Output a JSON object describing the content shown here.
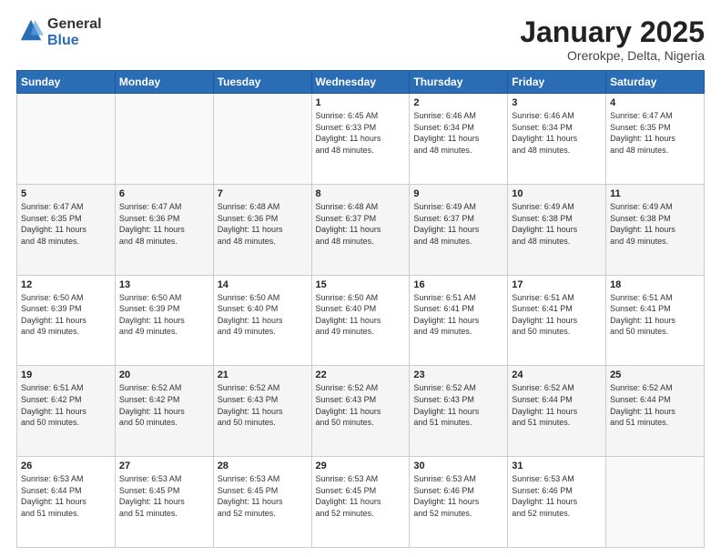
{
  "logo": {
    "general": "General",
    "blue": "Blue"
  },
  "header": {
    "title": "January 2025",
    "subtitle": "Orerokpe, Delta, Nigeria"
  },
  "weekdays": [
    "Sunday",
    "Monday",
    "Tuesday",
    "Wednesday",
    "Thursday",
    "Friday",
    "Saturday"
  ],
  "weeks": [
    [
      {
        "day": "",
        "info": ""
      },
      {
        "day": "",
        "info": ""
      },
      {
        "day": "",
        "info": ""
      },
      {
        "day": "1",
        "info": "Sunrise: 6:45 AM\nSunset: 6:33 PM\nDaylight: 11 hours\nand 48 minutes."
      },
      {
        "day": "2",
        "info": "Sunrise: 6:46 AM\nSunset: 6:34 PM\nDaylight: 11 hours\nand 48 minutes."
      },
      {
        "day": "3",
        "info": "Sunrise: 6:46 AM\nSunset: 6:34 PM\nDaylight: 11 hours\nand 48 minutes."
      },
      {
        "day": "4",
        "info": "Sunrise: 6:47 AM\nSunset: 6:35 PM\nDaylight: 11 hours\nand 48 minutes."
      }
    ],
    [
      {
        "day": "5",
        "info": "Sunrise: 6:47 AM\nSunset: 6:35 PM\nDaylight: 11 hours\nand 48 minutes."
      },
      {
        "day": "6",
        "info": "Sunrise: 6:47 AM\nSunset: 6:36 PM\nDaylight: 11 hours\nand 48 minutes."
      },
      {
        "day": "7",
        "info": "Sunrise: 6:48 AM\nSunset: 6:36 PM\nDaylight: 11 hours\nand 48 minutes."
      },
      {
        "day": "8",
        "info": "Sunrise: 6:48 AM\nSunset: 6:37 PM\nDaylight: 11 hours\nand 48 minutes."
      },
      {
        "day": "9",
        "info": "Sunrise: 6:49 AM\nSunset: 6:37 PM\nDaylight: 11 hours\nand 48 minutes."
      },
      {
        "day": "10",
        "info": "Sunrise: 6:49 AM\nSunset: 6:38 PM\nDaylight: 11 hours\nand 48 minutes."
      },
      {
        "day": "11",
        "info": "Sunrise: 6:49 AM\nSunset: 6:38 PM\nDaylight: 11 hours\nand 49 minutes."
      }
    ],
    [
      {
        "day": "12",
        "info": "Sunrise: 6:50 AM\nSunset: 6:39 PM\nDaylight: 11 hours\nand 49 minutes."
      },
      {
        "day": "13",
        "info": "Sunrise: 6:50 AM\nSunset: 6:39 PM\nDaylight: 11 hours\nand 49 minutes."
      },
      {
        "day": "14",
        "info": "Sunrise: 6:50 AM\nSunset: 6:40 PM\nDaylight: 11 hours\nand 49 minutes."
      },
      {
        "day": "15",
        "info": "Sunrise: 6:50 AM\nSunset: 6:40 PM\nDaylight: 11 hours\nand 49 minutes."
      },
      {
        "day": "16",
        "info": "Sunrise: 6:51 AM\nSunset: 6:41 PM\nDaylight: 11 hours\nand 49 minutes."
      },
      {
        "day": "17",
        "info": "Sunrise: 6:51 AM\nSunset: 6:41 PM\nDaylight: 11 hours\nand 50 minutes."
      },
      {
        "day": "18",
        "info": "Sunrise: 6:51 AM\nSunset: 6:41 PM\nDaylight: 11 hours\nand 50 minutes."
      }
    ],
    [
      {
        "day": "19",
        "info": "Sunrise: 6:51 AM\nSunset: 6:42 PM\nDaylight: 11 hours\nand 50 minutes."
      },
      {
        "day": "20",
        "info": "Sunrise: 6:52 AM\nSunset: 6:42 PM\nDaylight: 11 hours\nand 50 minutes."
      },
      {
        "day": "21",
        "info": "Sunrise: 6:52 AM\nSunset: 6:43 PM\nDaylight: 11 hours\nand 50 minutes."
      },
      {
        "day": "22",
        "info": "Sunrise: 6:52 AM\nSunset: 6:43 PM\nDaylight: 11 hours\nand 50 minutes."
      },
      {
        "day": "23",
        "info": "Sunrise: 6:52 AM\nSunset: 6:43 PM\nDaylight: 11 hours\nand 51 minutes."
      },
      {
        "day": "24",
        "info": "Sunrise: 6:52 AM\nSunset: 6:44 PM\nDaylight: 11 hours\nand 51 minutes."
      },
      {
        "day": "25",
        "info": "Sunrise: 6:52 AM\nSunset: 6:44 PM\nDaylight: 11 hours\nand 51 minutes."
      }
    ],
    [
      {
        "day": "26",
        "info": "Sunrise: 6:53 AM\nSunset: 6:44 PM\nDaylight: 11 hours\nand 51 minutes."
      },
      {
        "day": "27",
        "info": "Sunrise: 6:53 AM\nSunset: 6:45 PM\nDaylight: 11 hours\nand 51 minutes."
      },
      {
        "day": "28",
        "info": "Sunrise: 6:53 AM\nSunset: 6:45 PM\nDaylight: 11 hours\nand 52 minutes."
      },
      {
        "day": "29",
        "info": "Sunrise: 6:53 AM\nSunset: 6:45 PM\nDaylight: 11 hours\nand 52 minutes."
      },
      {
        "day": "30",
        "info": "Sunrise: 6:53 AM\nSunset: 6:46 PM\nDaylight: 11 hours\nand 52 minutes."
      },
      {
        "day": "31",
        "info": "Sunrise: 6:53 AM\nSunset: 6:46 PM\nDaylight: 11 hours\nand 52 minutes."
      },
      {
        "day": "",
        "info": ""
      }
    ]
  ]
}
